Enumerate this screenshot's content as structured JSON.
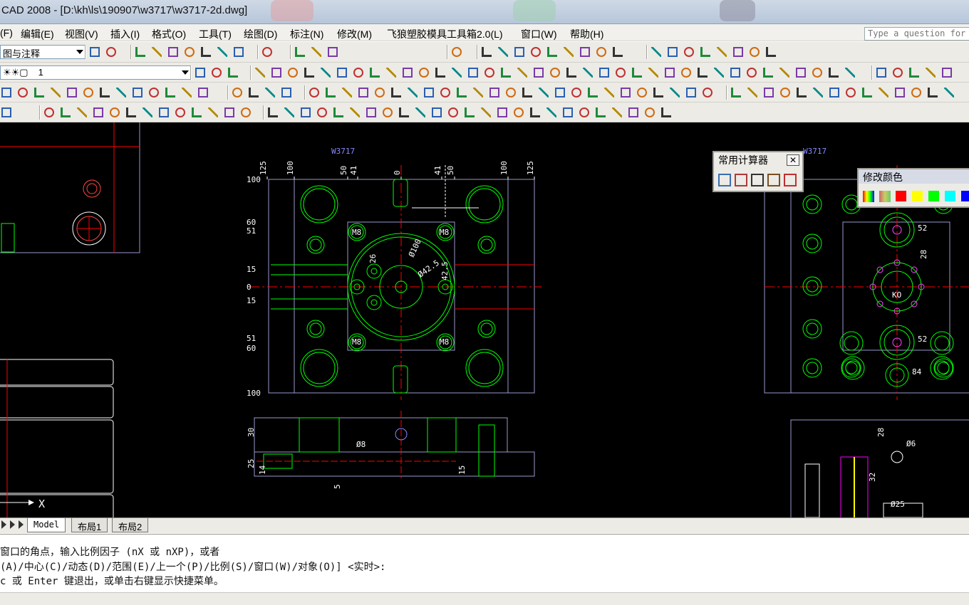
{
  "window": {
    "title": "CAD 2008 - [D:\\kh\\ls\\190907\\w3717\\w3717-2d.dwg]"
  },
  "menu": {
    "items": [
      "(F)",
      "编辑(E)",
      "视图(V)",
      "插入(I)",
      "格式(O)",
      "工具(T)",
      "绘图(D)",
      "标注(N)",
      "修改(M)",
      "飞狼塑胶模具工具箱2.0(L)",
      "窗口(W)",
      "帮助(H)"
    ],
    "ask_placeholder": "Type a question for help"
  },
  "toolbar": {
    "workspace_value": "图与注释",
    "layer_value": "1"
  },
  "palettes": {
    "calculator_title": "常用计算器",
    "close_label": "✕",
    "color_title": "修改颜色",
    "swatches": [
      "#ff0000",
      "#ffff00",
      "#00ff00",
      "#00ffff",
      "#0000ff"
    ]
  },
  "drawing": {
    "title_left": "W3717",
    "title_right": "W3717",
    "top_dims": [
      "125",
      "100",
      "50",
      "41",
      "0",
      "41",
      "50",
      "100",
      "125"
    ],
    "left_dims": [
      "100",
      "60",
      "51",
      "15",
      "0",
      "15",
      "51",
      "60",
      "100"
    ],
    "hole_labels": [
      "M8",
      "M8",
      "M8",
      "M8"
    ],
    "center_dims": [
      "26",
      "Ø100",
      "Ø42.5",
      "42.5"
    ],
    "section_dims": [
      "30",
      "25",
      "14",
      "5",
      "Ø8",
      "15"
    ],
    "right_dims": [
      "52",
      "28",
      "KO",
      "52",
      "84",
      "28",
      "Ø6",
      "32",
      "Ø25"
    ],
    "axis_label": "X"
  },
  "tabs": {
    "items": [
      "Model",
      "布局1",
      "布局2"
    ]
  },
  "command": {
    "lines": [
      "窗口的角点，输入比例因子 (nX 或 nXP)，或者",
      "(A)/中心(C)/动态(D)/范围(E)/上一个(P)/比例(S)/窗口(W)/对象(O)] <实时>:",
      "c 或 Enter 键退出，或单击右键显示快捷菜单。"
    ]
  },
  "colors": {
    "canvas": "#000000",
    "geometry": "#00ff00",
    "outline": "#9999cc",
    "centerline": "#ff0000",
    "dimension": "#ffffff"
  }
}
